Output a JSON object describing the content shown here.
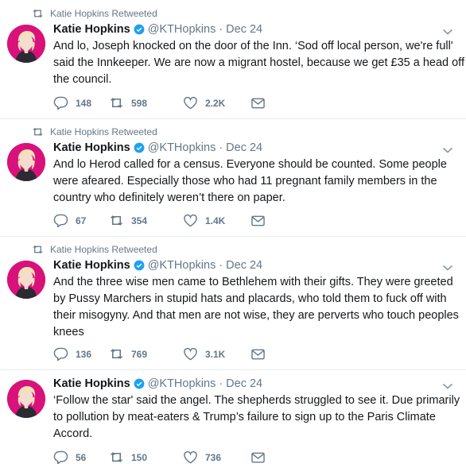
{
  "tweets": [
    {
      "retweeted_label": "Katie Hopkins Retweeted",
      "name": "Katie Hopkins",
      "handle": "@KTHopkins",
      "separator": "·",
      "date": "Dec 24",
      "lines": [
        "And lo, Joseph knocked on the door of the Inn. ‘Sod off local person, we're full'",
        "said the Innkeeper. We are now a migrant hostel, because we get £35 a head off",
        "the council."
      ],
      "replies": "148",
      "retweets": "598",
      "likes": "2.2K"
    },
    {
      "retweeted_label": "Katie Hopkins Retweeted",
      "name": "Katie Hopkins",
      "handle": "@KTHopkins",
      "separator": "·",
      "date": "Dec 24",
      "lines": [
        "And lo Herod called for a census. Everyone should be counted. Some people",
        "were afeared. Especially those who had 11 pregnant family members in the",
        "country who definitely weren’t there on paper."
      ],
      "replies": "67",
      "retweets": "354",
      "likes": "1.4K"
    },
    {
      "retweeted_label": "Katie Hopkins Retweeted",
      "name": "Katie Hopkins",
      "handle": "@KTHopkins",
      "separator": "·",
      "date": "Dec 24",
      "lines": [
        "And the three wise men came to Bethlehem with their gifts. They were greeted",
        "by Pussy Marchers in stupid hats and placards, who told them to fuck off with",
        "their misogyny. And that men are not wise, they are perverts who touch peoples",
        "knees"
      ],
      "replies": "136",
      "retweets": "769",
      "likes": "3.1K"
    },
    {
      "name": "Katie Hopkins",
      "handle": "@KTHopkins",
      "separator": "·",
      "date": "Dec 24",
      "lines": [
        "‘Follow the star' said the angel. The shepherds struggled to see it. Due primarily",
        "to pollution by meat-eaters & Trump’s failure to sign up to the Paris Climate",
        "Accord."
      ],
      "replies": "56",
      "retweets": "150",
      "likes": "736"
    }
  ],
  "icons": {
    "retweeted": "retweet-icon",
    "verified": "verified-badge-icon",
    "menu": "chevron-down-icon",
    "reply": "reply-icon",
    "retweet": "retweet-icon",
    "like": "heart-icon",
    "dm": "envelope-icon"
  },
  "colors": {
    "avatar_bg": "#d9117a",
    "verified": "#1da1f2",
    "muted": "#657786",
    "divider": "#e6ecf0"
  }
}
